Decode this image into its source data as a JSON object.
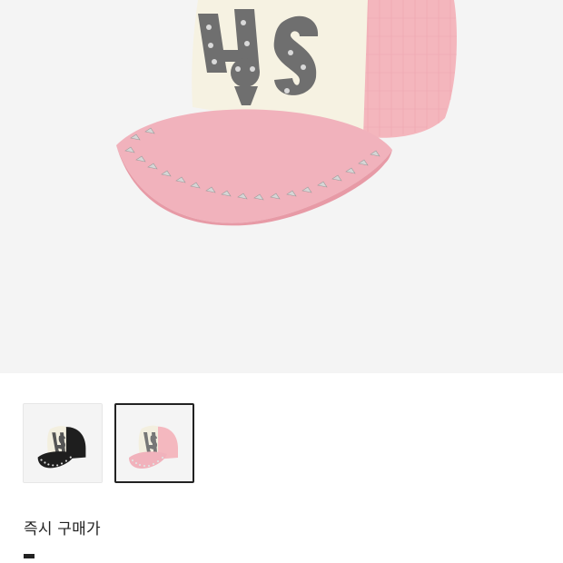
{
  "product": {
    "main_image": {
      "icon": "pink-trucker-cap-image",
      "colors": {
        "background": "#f4f4f4",
        "crown": "#f6f2e3",
        "mesh": "#f3b8bf",
        "brim": "#f1b2bc",
        "print": "#6d6d6d",
        "stud": "#cfcfcf"
      }
    },
    "thumbnails": [
      {
        "variant": "black",
        "selected": false,
        "icon": "black-cap-thumbnail"
      },
      {
        "variant": "pink",
        "selected": true,
        "icon": "pink-cap-thumbnail"
      }
    ],
    "price_label": "즉시 구매가",
    "price_value": "-"
  }
}
